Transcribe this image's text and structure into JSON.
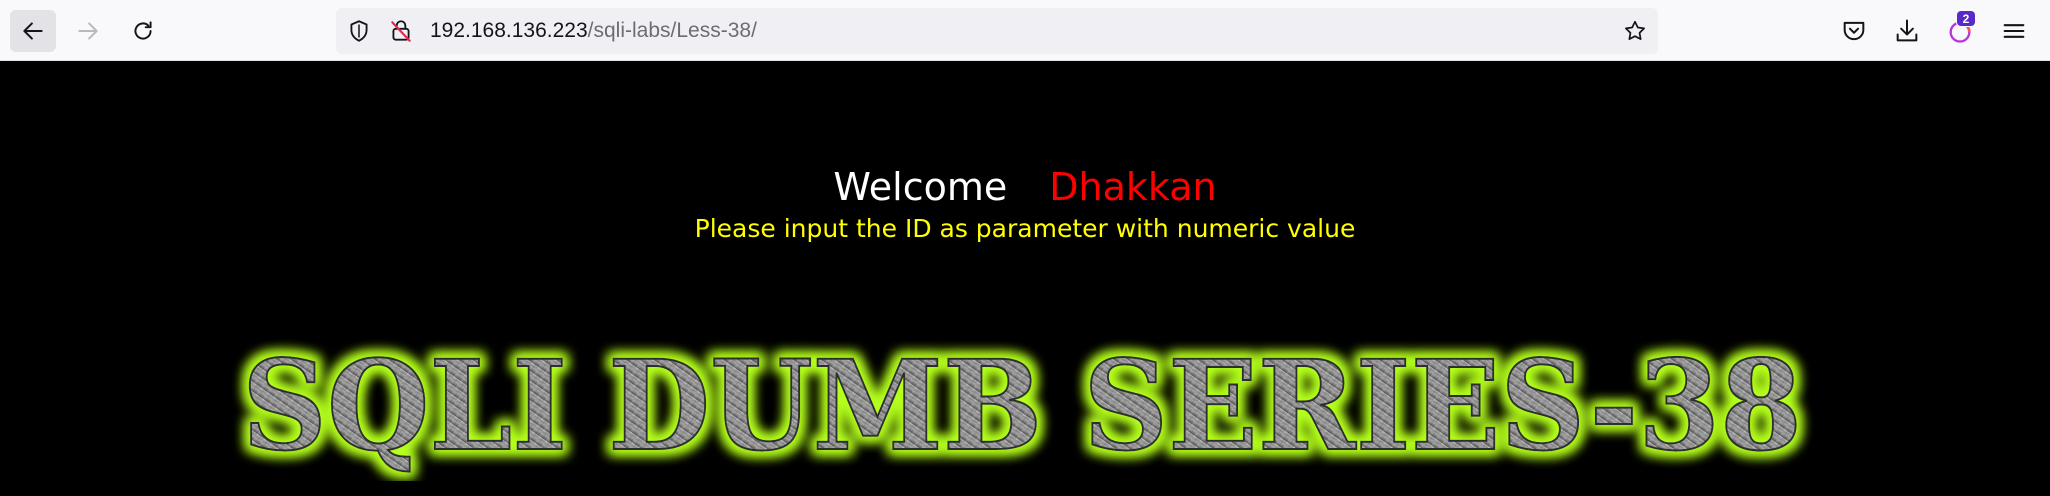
{
  "browser": {
    "url_host": "192.168.136.223",
    "url_path": "/sqli-labs/Less-38/",
    "notification_count": "2",
    "icons": {
      "back": "back-arrow-icon",
      "forward": "forward-arrow-icon",
      "reload": "reload-icon",
      "tracking": "shield-icon",
      "insecure": "insecure-lock-icon",
      "bookmark": "star-icon",
      "pocket": "pocket-icon",
      "downloads": "download-icon",
      "extension": "firefox-view-icon",
      "menu": "hamburger-menu-icon"
    }
  },
  "page": {
    "welcome": "Welcome",
    "name": "Dhakkan",
    "prompt": "Please input the ID as parameter with numeric value",
    "banner_text": "SQLI DUMB SERIES-38"
  },
  "colors": {
    "page_bg": "#000000",
    "welcome": "#ffffff",
    "name": "#ff0000",
    "prompt": "#ffff00",
    "banner_glow": "#b4ff1e",
    "banner_metal": "#8f8f8f",
    "toolbar_bg": "#f9f9fb",
    "badge": "#592acb"
  }
}
